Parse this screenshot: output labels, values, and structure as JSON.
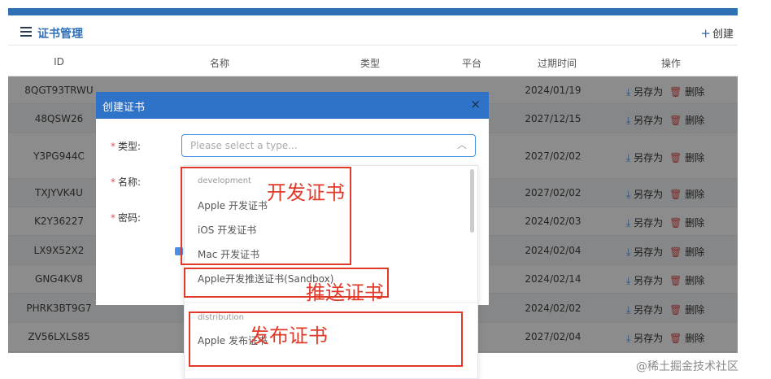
{
  "header": {
    "title": "证书管理",
    "create_label": "创建",
    "create_icon": "+"
  },
  "table": {
    "columns": [
      "ID",
      "名称",
      "类型",
      "平台",
      "过期时间",
      "操作"
    ],
    "rows": [
      {
        "id": "8QGT93TRWU",
        "date": "2024/01/19"
      },
      {
        "id": "48QSW26",
        "date": "2027/12/15"
      },
      {
        "id": "Y3PG944C",
        "date": "2027/02/02"
      },
      {
        "id": "TXJYVK4U",
        "date": "2027/02/02"
      },
      {
        "id": "K2Y36227",
        "date": "2024/02/03"
      },
      {
        "id": "LX9X52X2",
        "date": "2024/02/04"
      },
      {
        "id": "GNG4KV8",
        "date": "2024/02/14"
      },
      {
        "id": "PHRK3BT9G7",
        "date": "2024/02/02"
      },
      {
        "id": "ZV56LXLS85",
        "date": "2027/02/04"
      }
    ],
    "action_save": "另存为",
    "action_delete": "删除"
  },
  "modal": {
    "title": "创建证书",
    "close": "×",
    "label_type": "类型:",
    "label_name": "名称:",
    "label_password": "密码:",
    "required_mark": "*",
    "type_placeholder": "Please select a type..."
  },
  "dropdown": {
    "group_development": "development",
    "dev_options": [
      "Apple 开发证书",
      "iOS 开发证书",
      "Mac 开发证书",
      "Apple开发推送证书(Sandbox)"
    ],
    "group_distribution": "distribution",
    "dist_options": [
      "Apple 发布证书"
    ]
  },
  "annotations": {
    "dev": "开发证书",
    "push": "推送证书",
    "dist": "发布证书"
  },
  "watermark": "@稀土掘金技术社区",
  "colors": {
    "accent": "#2f6fb4",
    "annotation": "#e23a2a",
    "modal_header": "#2f73c9"
  }
}
